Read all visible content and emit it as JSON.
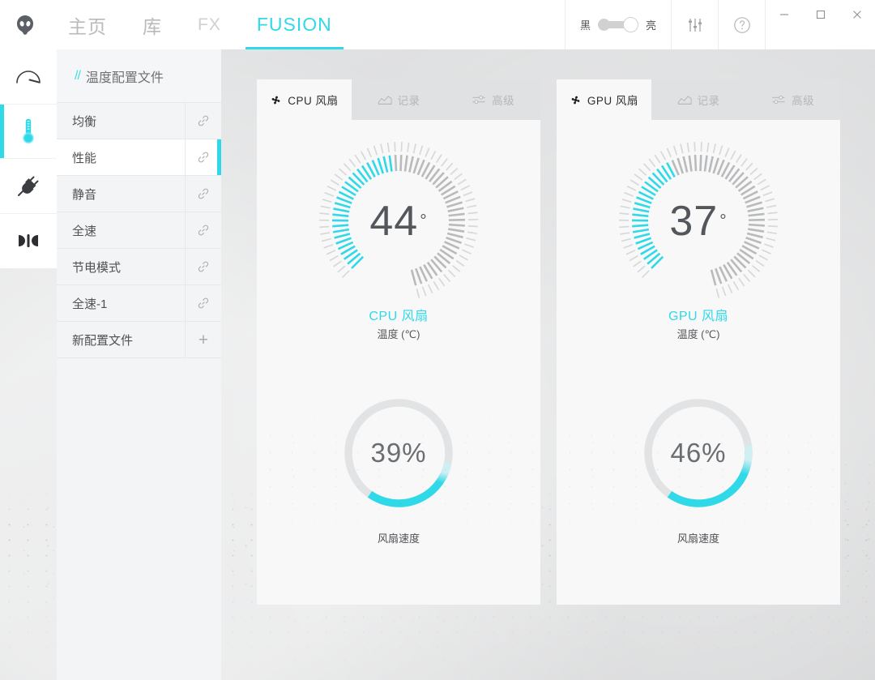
{
  "app": {
    "logo_icon": "alienware-head-icon",
    "accent_color": "#2fd9e8",
    "panel_bg": "#f8f8f8"
  },
  "titlebar": {
    "nav": [
      {
        "label": "主页",
        "active": false,
        "dim": false
      },
      {
        "label": "库",
        "active": false,
        "dim": false
      },
      {
        "label": "FX",
        "active": false,
        "dim": true
      },
      {
        "label": "FUSION",
        "active": true,
        "dim": false
      }
    ],
    "theme_toggle": {
      "dark_label": "黑",
      "light_label": "亮",
      "state": "light"
    },
    "settings_icon": "sliders-icon",
    "help_icon": "question-circle-icon",
    "window_controls": {
      "minimize": "minimize-icon",
      "maximize": "maximize-icon",
      "close": "close-icon"
    }
  },
  "rail": {
    "items": [
      {
        "icon": "gauge-icon",
        "active": false
      },
      {
        "icon": "thermometer-icon",
        "active": true
      },
      {
        "icon": "power-plug-icon",
        "active": false
      },
      {
        "icon": "audio-icon",
        "active": false
      }
    ]
  },
  "profiles": {
    "header": {
      "slashes": "//",
      "title": "温度配置文件"
    },
    "rows": [
      {
        "name": "均衡",
        "action": "link-icon",
        "active": false
      },
      {
        "name": "性能",
        "action": "link-icon",
        "active": true
      },
      {
        "name": "静音",
        "action": "link-icon",
        "active": false
      },
      {
        "name": "全速",
        "action": "link-icon",
        "active": false
      },
      {
        "name": "节电模式",
        "action": "link-icon",
        "active": false
      },
      {
        "name": "全速-1",
        "action": "link-icon",
        "active": false
      },
      {
        "name": "新配置文件",
        "action": "plus-icon",
        "active": false,
        "plus": "+"
      }
    ]
  },
  "panels": [
    {
      "key": "cpu",
      "tabs": [
        {
          "label": "CPU 风扇",
          "icon": "fan-icon",
          "active": true
        },
        {
          "label": "记录",
          "icon": "chart-icon",
          "active": false
        },
        {
          "label": "高级",
          "icon": "sliders-icon",
          "active": false
        }
      ],
      "temp_gauge": {
        "value": "44",
        "degree": "°",
        "caption": "CPU 风扇",
        "sub_caption": "温度 (℃)",
        "fill_fraction": 0.44,
        "ticks": 60
      },
      "speed_ring": {
        "value": "39%",
        "caption": "风扇速度",
        "fill_fraction": 0.39
      }
    },
    {
      "key": "gpu",
      "tabs": [
        {
          "label": "GPU 风扇",
          "icon": "fan-icon",
          "active": true
        },
        {
          "label": "记录",
          "icon": "chart-icon",
          "active": false
        },
        {
          "label": "高级",
          "icon": "sliders-icon",
          "active": false
        }
      ],
      "temp_gauge": {
        "value": "37",
        "degree": "°",
        "caption": "GPU 风扇",
        "sub_caption": "温度 (℃)",
        "fill_fraction": 0.37,
        "ticks": 60
      },
      "speed_ring": {
        "value": "46%",
        "caption": "风扇速度",
        "fill_fraction": 0.46
      }
    }
  ]
}
